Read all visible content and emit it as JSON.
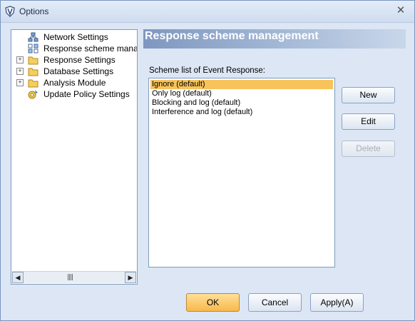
{
  "window": {
    "title": "Options",
    "close_glyph": "✕"
  },
  "tree": {
    "items": [
      {
        "label": "Network Settings",
        "icon": "network-icon",
        "expandable": false
      },
      {
        "label": "Response scheme manage",
        "icon": "scheme-icon",
        "expandable": false
      },
      {
        "label": "Response Settings",
        "icon": "folder-icon",
        "expandable": true
      },
      {
        "label": "Database Settings",
        "icon": "folder-icon",
        "expandable": true
      },
      {
        "label": "Analysis Module",
        "icon": "folder-icon",
        "expandable": true
      },
      {
        "label": "Update Policy Settings",
        "icon": "update-policy-icon",
        "expandable": false
      }
    ],
    "expand_glyph": "+",
    "scroll_left_glyph": "◀",
    "scroll_right_glyph": "▶"
  },
  "panel": {
    "header": "Response scheme management",
    "list_label": "Scheme list of Event Response:",
    "schemes": [
      {
        "label": "Ignore (default)",
        "selected": true
      },
      {
        "label": "Only log (default)",
        "selected": false
      },
      {
        "label": "Blocking and log (default)",
        "selected": false
      },
      {
        "label": "Interference and log (default)",
        "selected": false
      }
    ],
    "buttons": {
      "new": "New",
      "edit": "Edit",
      "delete": "Delete"
    }
  },
  "footer": {
    "ok": "OK",
    "cancel": "Cancel",
    "apply": "Apply(A)"
  }
}
